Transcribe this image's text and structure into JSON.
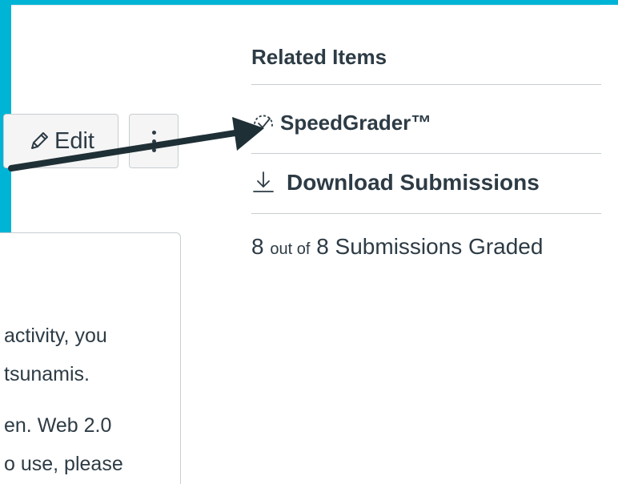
{
  "toolbar": {
    "edit_label": "Edit",
    "edit_icon": "pencil-icon",
    "more_icon": "kebab-icon"
  },
  "description": {
    "lines": [
      "activity, you",
      "tsunamis.",
      "en.  Web 2.0",
      "o use, please"
    ]
  },
  "sidebar": {
    "title": "Related Items",
    "speedgrader_label": "SpeedGrader™",
    "speedgrader_icon": "speedgrader-icon",
    "download_label": "Download Submissions",
    "download_icon": "download-icon",
    "graded": {
      "graded_count": "8",
      "out_of": "out of",
      "total": "8",
      "suffix": "Submissions Graded"
    }
  },
  "colors": {
    "frame": "#00b4d6",
    "text": "#2d3b45",
    "border": "#c7cdd1",
    "button_bg": "#f5f5f5",
    "arrow": "#1f2f36"
  }
}
